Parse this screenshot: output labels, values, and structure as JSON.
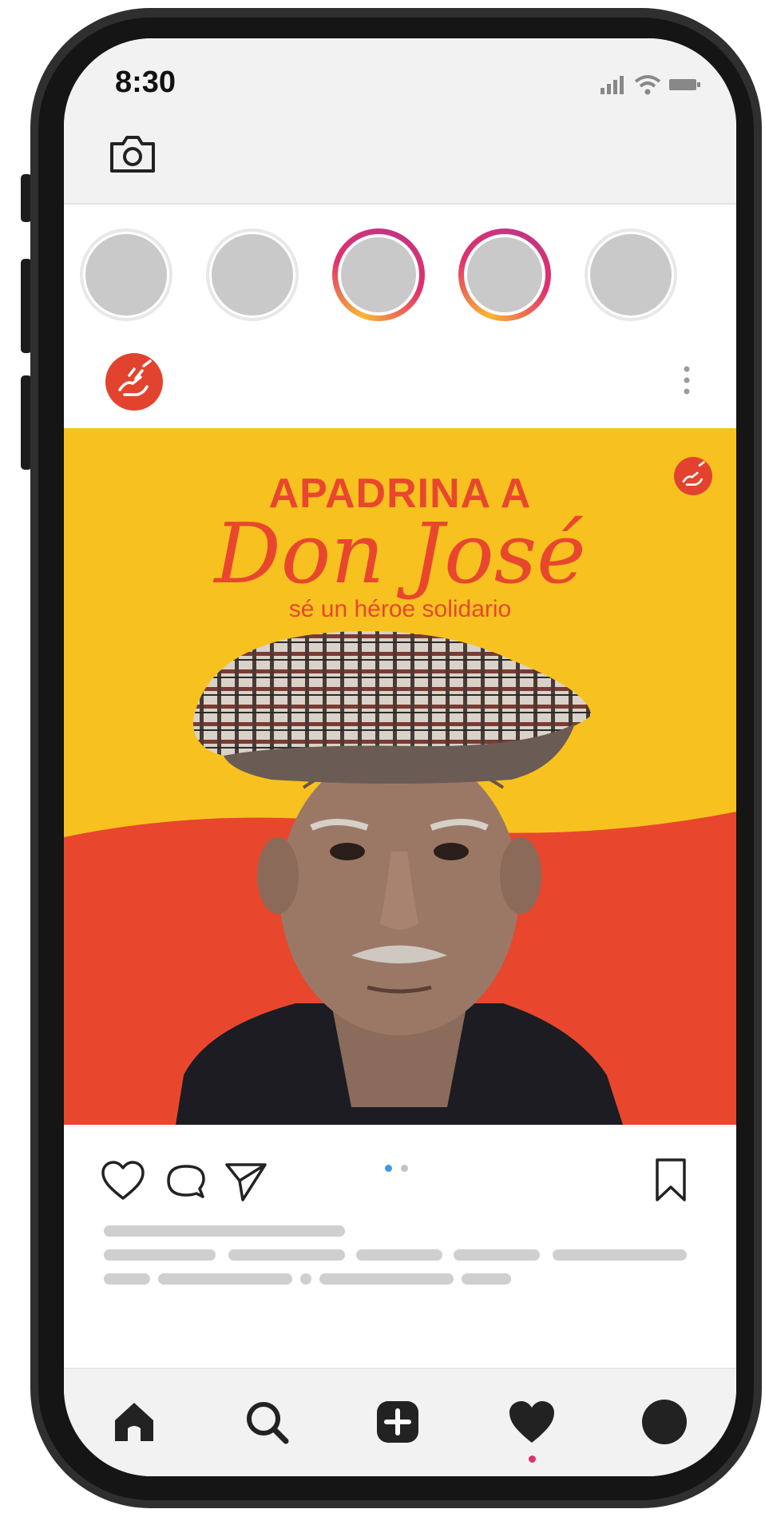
{
  "status": {
    "time": "8:30"
  },
  "post": {
    "title": "APADRINA A",
    "script": "Don José",
    "subtitle": "sé un héroe solidario"
  },
  "colors": {
    "accent": "#e8472e",
    "banner": "#f7c21f",
    "active_dot": "#e1306c"
  },
  "icons": {
    "camera": "camera-icon",
    "more": "more-vertical-icon",
    "like": "heart-outline-icon",
    "comment": "comment-icon",
    "share": "send-icon",
    "save": "bookmark-icon",
    "home": "home-icon",
    "search": "search-icon",
    "add": "add-square-icon",
    "activity": "heart-filled-icon",
    "profile": "profile-icon"
  },
  "carousel": {
    "page": 1,
    "pages": 2
  },
  "stories": [
    {
      "state": "seen"
    },
    {
      "state": "seen"
    },
    {
      "state": "new"
    },
    {
      "state": "new"
    },
    {
      "state": "seen"
    }
  ]
}
